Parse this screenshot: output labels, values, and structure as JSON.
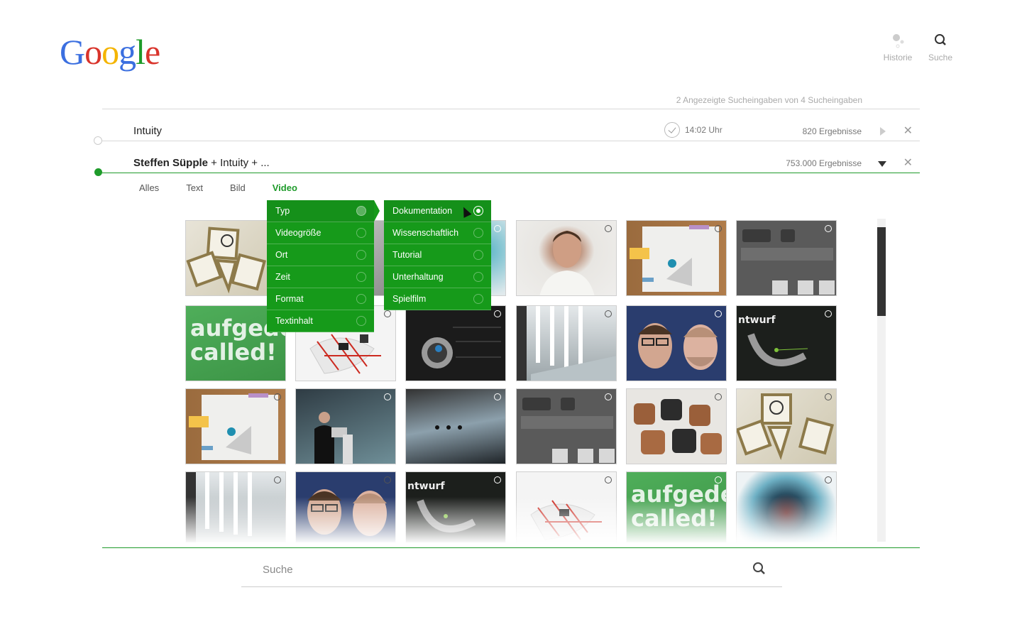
{
  "logo": {
    "letters": [
      "G",
      "o",
      "o",
      "g",
      "l",
      "e"
    ],
    "colors": [
      "#3b6fe0",
      "#d9342b",
      "#f4b400",
      "#3b6fe0",
      "#1e9b2a",
      "#d9342b"
    ]
  },
  "top_buttons": {
    "history_label": "Historie",
    "search_label": "Suche"
  },
  "summary": {
    "text": "2 Angezeigte  Sucheingaben von 4 Sucheingaben"
  },
  "queries": [
    {
      "text": "Intuity",
      "time": "14:02 Uhr",
      "results": "820 Ergebnisse"
    },
    {
      "bold": "Steffen Süpple",
      "rest": " + Intuity + ...",
      "results": "753.000 Ergebnisse"
    }
  ],
  "tabs": [
    {
      "label": "Alles",
      "active": false
    },
    {
      "label": "Text",
      "active": false
    },
    {
      "label": "Bild",
      "active": false
    },
    {
      "label": "Video",
      "active": true
    }
  ],
  "menu_primary": [
    "Typ",
    "Videogröße",
    "Ort",
    "Zeit",
    "Format",
    "Textinhalt"
  ],
  "menu_secondary": [
    "Dokumentation",
    "Wissenschaftlich",
    "Tutorial",
    "Unterhaltung",
    "Spielfilm"
  ],
  "selected_primary": "Typ",
  "selected_secondary": "Dokumentation",
  "thumb_labels": {
    "aufgede": "aufgede\ncalled!",
    "entwurf": "ntwurf"
  },
  "search": {
    "placeholder": "Suche"
  },
  "colors": {
    "accent": "#1e9b2a",
    "menu": "#169a1a"
  }
}
